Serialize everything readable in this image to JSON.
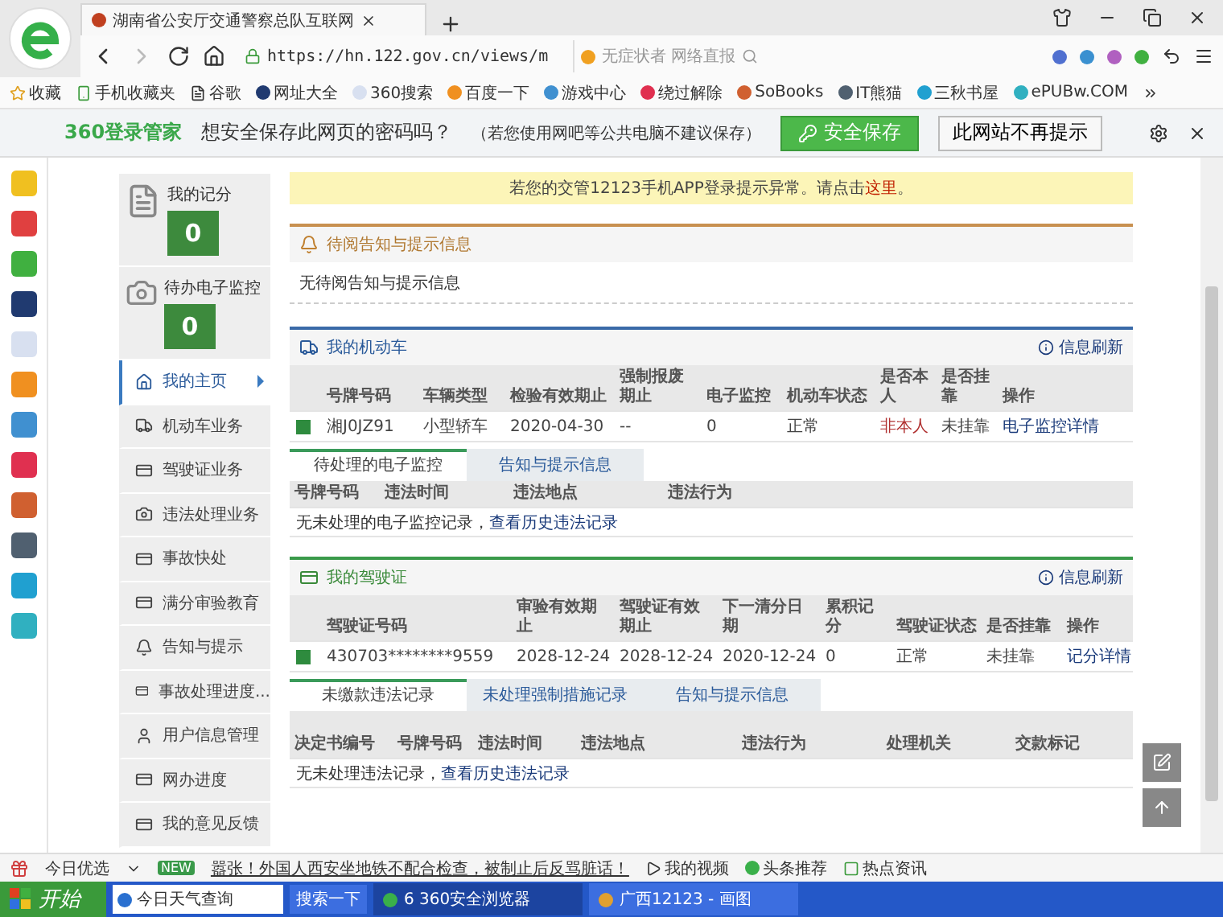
{
  "browser": {
    "tab_title": "湖南省公安厅交通警察总队互联网",
    "url": "https://hn.122.gov.cn/views/m",
    "search_placeholder": "无症状者 网络直报"
  },
  "bookmarks": [
    "收藏",
    "手机收藏夹",
    "谷歌",
    "网址大全",
    "360搜索",
    "百度一下",
    "游戏中心",
    "绕过解除",
    "SoBooks",
    "IT熊猫",
    "三秋书屋",
    "ePUBw.COM"
  ],
  "password_bar": {
    "brand": "360登录管家",
    "question": "想安全保存此网页的密码吗？",
    "hint": "（若您使用网吧等公共电脑不建议保存）",
    "save": "安全保存",
    "never": "此网站不再提示"
  },
  "nav": {
    "cards": [
      {
        "label": "我的记分",
        "value": "0",
        "kind": "score"
      },
      {
        "label": "待办电子监控",
        "value": "0",
        "kind": "camera"
      }
    ],
    "items": [
      {
        "label": "我的主页",
        "selected": true
      },
      {
        "label": "机动车业务",
        "selected": false
      },
      {
        "label": "驾驶证业务",
        "selected": false
      },
      {
        "label": "违法处理业务",
        "selected": false
      },
      {
        "label": "事故快处",
        "selected": false
      },
      {
        "label": "满分审验教育",
        "selected": false
      },
      {
        "label": "告知与提示",
        "selected": false
      },
      {
        "label": "事故处理进度...",
        "selected": false
      },
      {
        "label": "用户信息管理",
        "selected": false
      },
      {
        "label": "网办进度",
        "selected": false
      },
      {
        "label": "我的意见反馈",
        "selected": false
      }
    ]
  },
  "notice": {
    "text": "若您的交管12123手机APP登录提示异常。请点击",
    "link": "这里",
    "after": "。"
  },
  "pending": {
    "title": "待阅告知与提示信息",
    "body": "无待阅告知与提示信息"
  },
  "vehicles": {
    "title": "我的机动车",
    "refresh": "信息刷新",
    "columns": [
      "号牌号码",
      "车辆类型",
      "检验有效期止",
      "强制报废期止",
      "电子监控",
      "机动车状态",
      "是否本人",
      "是否挂靠",
      "操作"
    ],
    "rows": [
      {
        "color": "#2e8b3e",
        "cells": [
          {
            "text": "湘J0JZ91",
            "kind": "text"
          },
          {
            "text": "小型轿车",
            "kind": "text"
          },
          {
            "text": "2020-04-30",
            "kind": "text"
          },
          {
            "text": "--",
            "kind": "text"
          },
          {
            "text": "0",
            "kind": "text"
          },
          {
            "text": "正常",
            "kind": "text"
          },
          {
            "text": "非本人",
            "kind": "warn"
          },
          {
            "text": "未挂靠",
            "kind": "text"
          },
          {
            "text": "电子监控详情",
            "kind": "link"
          }
        ]
      }
    ],
    "tabs": [
      {
        "label": "待处理的电子监控",
        "selected": true
      },
      {
        "label": "告知与提示信息",
        "selected": false
      }
    ],
    "sub_columns": [
      "号牌号码",
      "违法时间",
      "违法地点",
      "违法行为"
    ],
    "message": {
      "text": "无未处理的电子监控记录，",
      "link": "查看历史违法记录"
    }
  },
  "licenses": {
    "title": "我的驾驶证",
    "refresh": "信息刷新",
    "columns": [
      "驾驶证号码",
      "审验有效期止",
      "驾驶证有效期止",
      "下一清分日期",
      "累积记分",
      "驾驶证状态",
      "是否挂靠",
      "操作"
    ],
    "rows": [
      {
        "color": "#2e8b3e",
        "cells": [
          {
            "text": "430703********9559",
            "kind": "text"
          },
          {
            "text": "2028-12-24",
            "kind": "text"
          },
          {
            "text": "2028-12-24",
            "kind": "text"
          },
          {
            "text": "2020-12-24",
            "kind": "text"
          },
          {
            "text": "0",
            "kind": "text"
          },
          {
            "text": "正常",
            "kind": "text"
          },
          {
            "text": "未挂靠",
            "kind": "text"
          },
          {
            "text": "记分详情",
            "kind": "link"
          }
        ]
      }
    ],
    "tabs": [
      {
        "label": "未缴款违法记录",
        "selected": true
      },
      {
        "label": "未处理强制措施记录",
        "selected": false
      },
      {
        "label": "告知与提示信息",
        "selected": false
      }
    ],
    "sub_columns": [
      "决定书编号",
      "号牌号码",
      "违法时间",
      "违法地点",
      "违法行为",
      "处理机关",
      "交款标记"
    ],
    "message": {
      "text": "无未处理违法记录，",
      "link": "查看历史违法记录"
    }
  },
  "news_bar": {
    "label": "今日优选",
    "badge": "NEW",
    "headline": "嚣张！外国人西安坐地铁不配合检查，被制止后反骂脏话！",
    "links": [
      "我的视频",
      "头条推荐",
      "热点资讯"
    ]
  },
  "taskbar": {
    "start": "开始",
    "search_value": "今日天气查询",
    "search_button": "搜索一下",
    "tasks": [
      "6 360安全浏览器",
      "广西12123 - 画图"
    ]
  }
}
